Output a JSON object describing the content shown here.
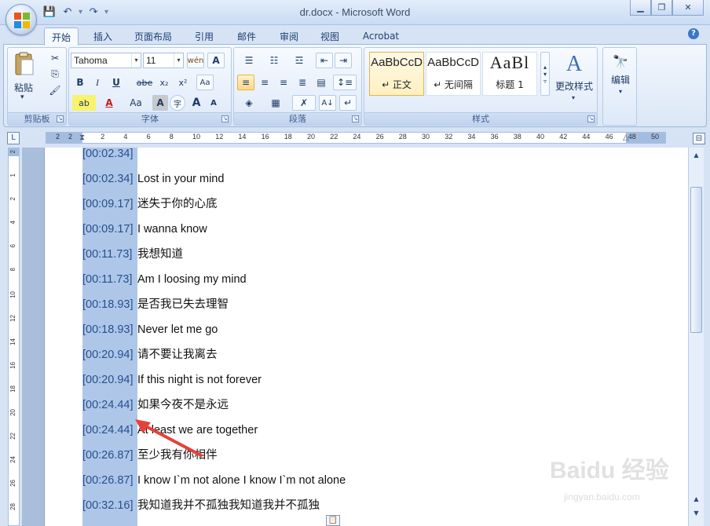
{
  "window": {
    "title": "dr.docx - Microsoft Word",
    "controls": {
      "minimize": "▁",
      "restore": "❐",
      "close": "✕"
    }
  },
  "qat": {
    "save_icon": "💾",
    "undo_icon": "↶",
    "redo_icon": "↷",
    "customize": "▾"
  },
  "tabs": [
    "开始",
    "插入",
    "页面布局",
    "引用",
    "邮件",
    "审阅",
    "视图",
    "Acrobat"
  ],
  "ribbon": {
    "clipboard": {
      "label": "剪贴板",
      "paste": "粘贴",
      "cut_icon": "✂",
      "copy_icon": "⎘",
      "format_painter_icon": "🖌"
    },
    "font": {
      "label": "字体",
      "font_name": "Tahoma",
      "font_size": "11",
      "bold": "B",
      "italic": "I",
      "underline": "U",
      "strike": "abe",
      "subscript": "x₂",
      "superscript": "x²",
      "grow": "A",
      "shrink": "A",
      "change_case": "Aa",
      "char_border": "A",
      "phonetic": "文",
      "char_shade": "A",
      "encircle": "字"
    },
    "paragraph": {
      "label": "段落"
    },
    "styles": {
      "label": "样式",
      "items": [
        {
          "sample": "AaBbCcD",
          "name": "↵ 正文"
        },
        {
          "sample": "AaBbCcD",
          "name": "↵ 无间隔"
        },
        {
          "sample": "AaBl",
          "name": "标题 1"
        }
      ],
      "change_styles": "更改样式"
    },
    "editing": {
      "label": "编辑"
    }
  },
  "ruler": {
    "left_numbers": [
      "2",
      "2"
    ],
    "numbers": [
      "2",
      "4",
      "6",
      "8",
      "10",
      "12",
      "14",
      "16",
      "18",
      "20",
      "22",
      "24",
      "26",
      "28",
      "30",
      "32",
      "34",
      "36",
      "38",
      "40",
      "42",
      "44",
      "46",
      "48",
      "50"
    ],
    "vertical_numbers": [
      "2",
      "1",
      "2",
      "4",
      "6",
      "8",
      "10",
      "12",
      "14",
      "16",
      "18",
      "20",
      "22",
      "24",
      "26",
      "28"
    ]
  },
  "document": {
    "lines": [
      {
        "ts": "[00:02.34]",
        "text": ""
      },
      {
        "ts": "[00:02.34]",
        "text": "Lost in your mind"
      },
      {
        "ts": "[00:09.17]",
        "text": "迷失于你的心底"
      },
      {
        "ts": "[00:09.17]",
        "text": "I wanna know"
      },
      {
        "ts": "[00:11.73]",
        "text": "我想知道"
      },
      {
        "ts": "[00:11.73]",
        "text": "Am I loosing my mind"
      },
      {
        "ts": "[00:18.93]",
        "text": "是否我已失去理智"
      },
      {
        "ts": "[00:18.93]",
        "text": "Never let me go"
      },
      {
        "ts": "[00:20.94]",
        "text": "请不要让我离去"
      },
      {
        "ts": "[00:20.94]",
        "text": "If this night is not forever"
      },
      {
        "ts": "[00:24.44]",
        "text": "如果今夜不是永远"
      },
      {
        "ts": "[00:24.44]",
        "text": "At least we are together"
      },
      {
        "ts": "[00:26.87]",
        "text": "至少我有你相伴"
      },
      {
        "ts": "[00:26.87]",
        "text": "I know I`m not alone I know I`m not alone"
      },
      {
        "ts": "[00:32.16]",
        "text": "我知道我并不孤独我知道我并不孤独"
      }
    ]
  },
  "watermark": {
    "logo": "Baidu 经验",
    "sub": "jingyan.baidu.com"
  },
  "colors": {
    "selection": "#aec7e8",
    "ribbon": "#dbe7f6",
    "arrow": "#e8403a"
  }
}
